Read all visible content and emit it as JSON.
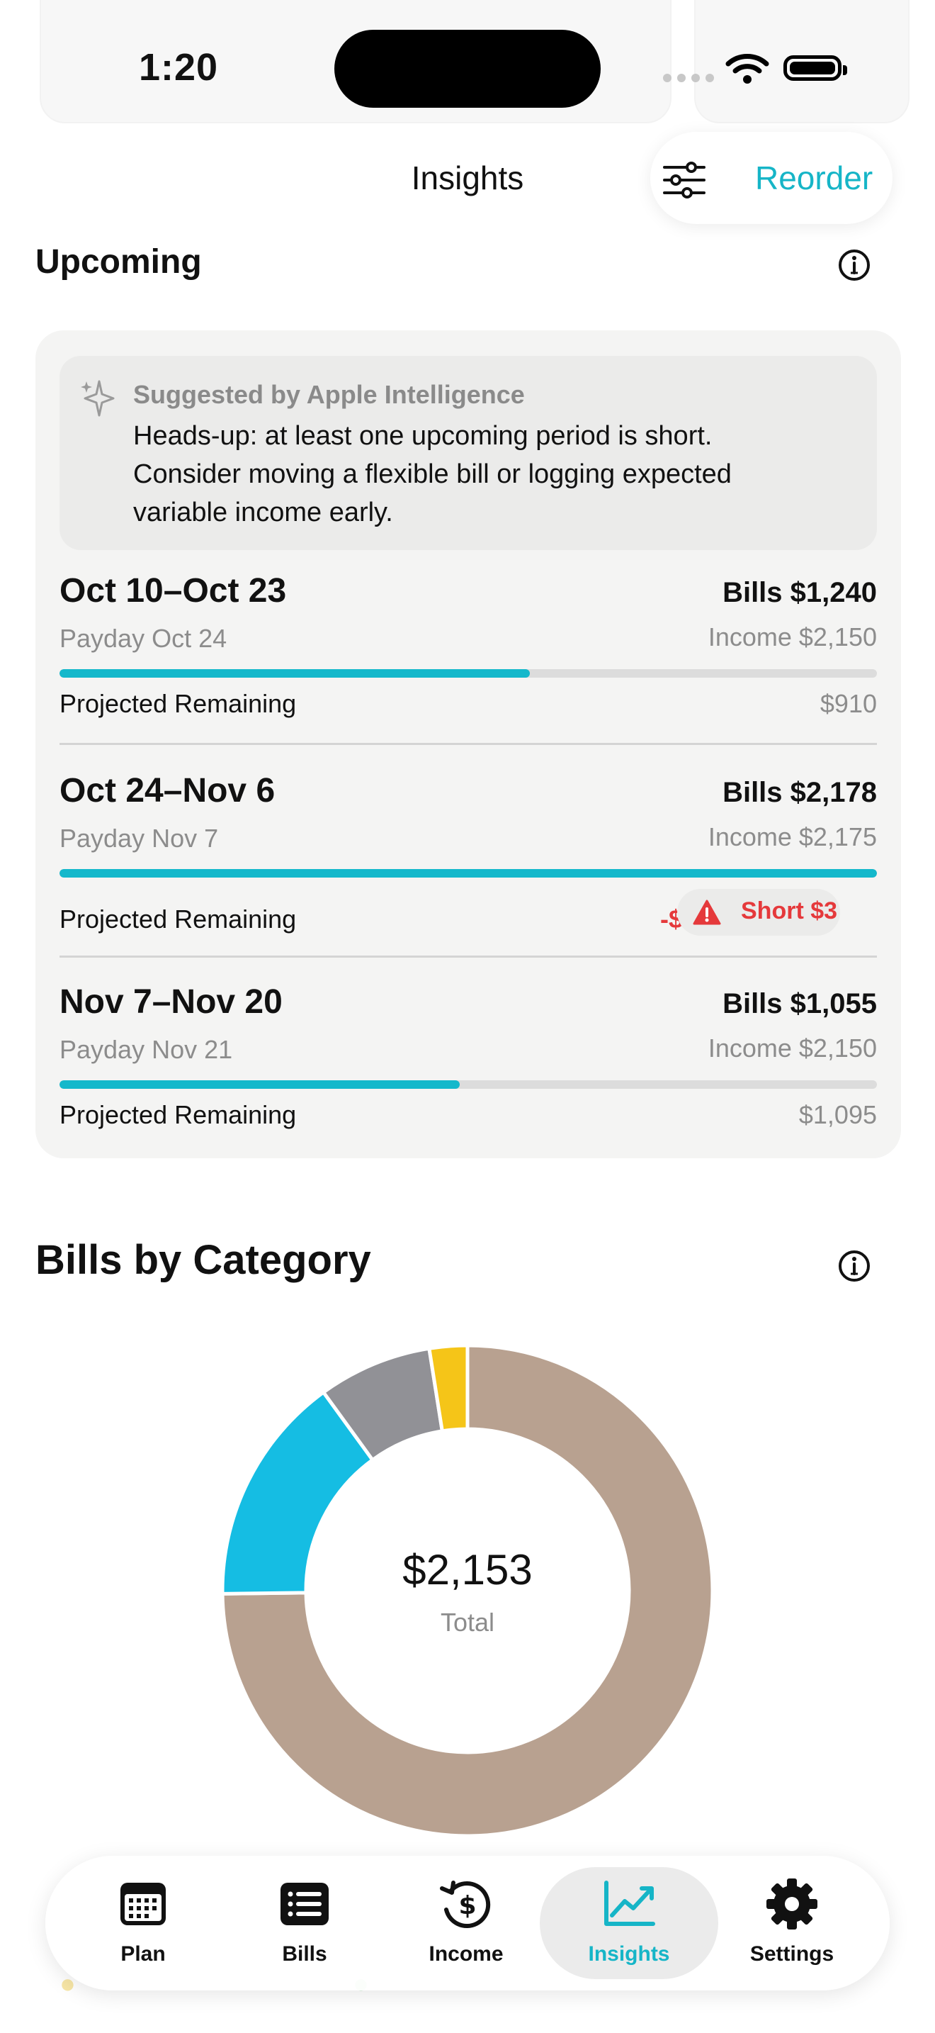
{
  "status_bar": {
    "time": "1:20"
  },
  "header": {
    "title": "Insights",
    "reorder_label": "Reorder"
  },
  "upcoming": {
    "title": "Upcoming",
    "suggestion": {
      "label": "Suggested by Apple Intelligence",
      "text": "Heads-up: at least one upcoming period is short. Consider moving a flexible bill or logging expected variable income early."
    },
    "remaining_label": "Projected Remaining",
    "periods": [
      {
        "dates": "Oct 10–Oct 23",
        "payday": "Payday Oct 24",
        "bills": "Bills $1,240",
        "income": "Income $2,150",
        "remaining": "$910",
        "progress": 0.575
      },
      {
        "dates": "Oct 24–Nov 6",
        "payday": "Payday Nov 7",
        "bills": "Bills $2,178",
        "income": "Income $2,175",
        "remaining": "-$3",
        "short": "Short $3",
        "progress": 1.0
      },
      {
        "dates": "Nov 7–Nov 20",
        "payday": "Payday Nov 21",
        "bills": "Bills $1,055",
        "income": "Income $2,150",
        "remaining": "$1,095",
        "progress": 0.49
      }
    ]
  },
  "bills_by_category": {
    "title": "Bills by Category",
    "total": "$2,153",
    "total_label": "Total"
  },
  "chart_data": {
    "type": "pie",
    "title": "Bills by Category",
    "center_value": "$2,153",
    "center_label": "Total",
    "slices": [
      {
        "value": 0.748,
        "color": "#b8a190"
      },
      {
        "value": 0.152,
        "color": "#15bde3"
      },
      {
        "value": 0.075,
        "color": "#919196"
      },
      {
        "value": 0.025,
        "color": "#f5c518"
      }
    ]
  },
  "tabs": [
    {
      "label": "Plan",
      "icon": "calendar-icon"
    },
    {
      "label": "Bills",
      "icon": "list-icon"
    },
    {
      "label": "Income",
      "icon": "dollar-history-icon"
    },
    {
      "label": "Insights",
      "icon": "chart-line-icon",
      "active": true
    },
    {
      "label": "Settings",
      "icon": "gear-icon"
    }
  ],
  "colors": {
    "accent": "#16b5c7",
    "negative": "#e5393b"
  }
}
